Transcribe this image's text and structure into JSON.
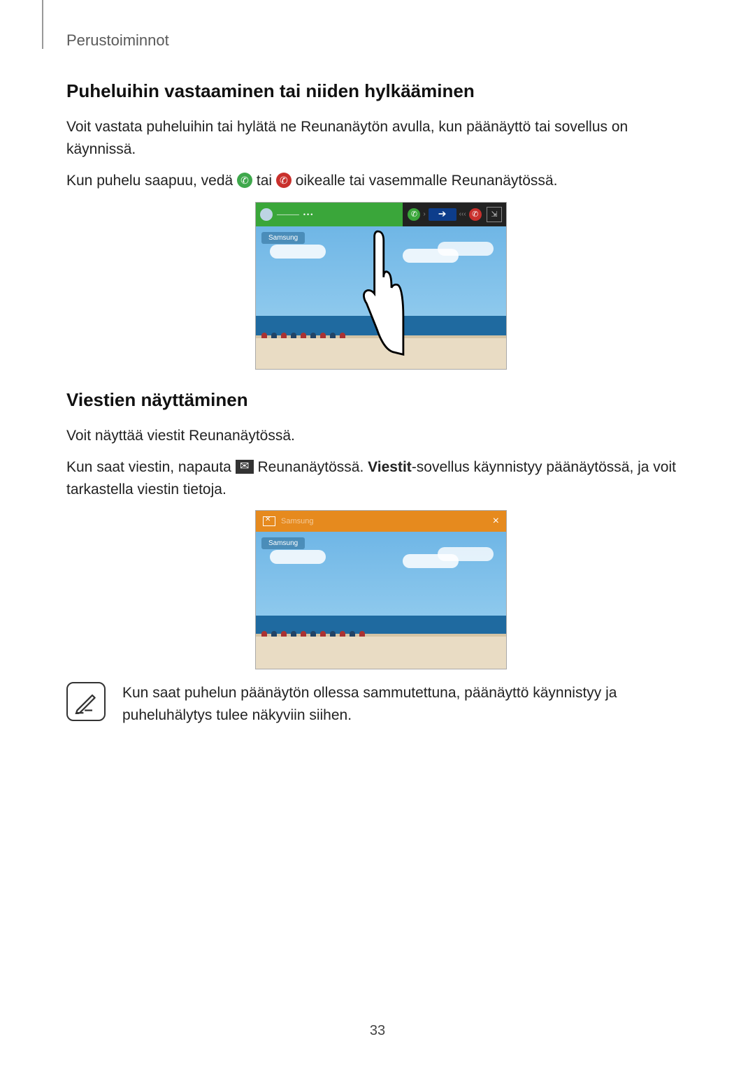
{
  "header": {
    "section_label": "Perustoiminnot"
  },
  "section1": {
    "heading": "Puheluihin vastaaminen tai niiden hylkääminen",
    "para1": "Voit vastata puheluihin tai hylätä ne Reunanäytön avulla, kun päänäyttö tai sovellus on käynnissä.",
    "para2_a": "Kun puhelu saapuu, vedä ",
    "para2_b": " tai ",
    "para2_c": " oikealle tai vasemmalle Reunanäytössä."
  },
  "figure1": {
    "caller_tag": "Samsung"
  },
  "section2": {
    "heading": "Viestien näyttäminen",
    "para1": "Voit näyttää viestit Reunanäytössä.",
    "para2_a": "Kun saat viestin, napauta ",
    "para2_b": " Reunanäytössä. ",
    "para2_bold": "Viestit",
    "para2_c": "-sovellus käynnistyy päänäytössä, ja voit tarkastella viestin tietoja."
  },
  "figure2": {
    "bar_sender": "Samsung",
    "below_tag": "Samsung"
  },
  "note": {
    "text": "Kun saat puhelun päänäytön ollessa sammutettuna, päänäyttö käynnistyy ja puheluhälytys tulee näkyviin siihen."
  },
  "page_number": "33"
}
